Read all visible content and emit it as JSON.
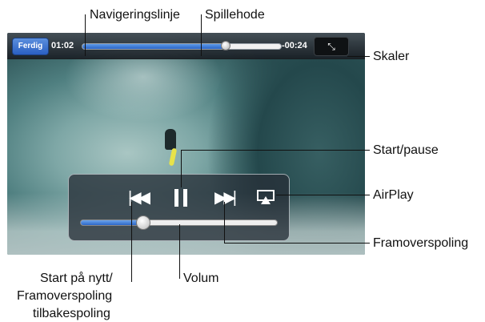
{
  "player": {
    "done_label": "Ferdig",
    "time_elapsed": "01:02",
    "time_remaining": "-00:24",
    "scrub_progress": 0.72,
    "volume_level": 0.32,
    "scale_icon": "shrink-arrows-icon",
    "prev_icon": "skip-back-icon",
    "pause_icon": "pause-icon",
    "next_icon": "skip-forward-icon",
    "airplay_icon": "airplay-icon"
  },
  "callouts": {
    "scrubber": "Navigeringslinje",
    "playhead": "Spillehode",
    "scale": "Skaler",
    "play_pause": "Start/pause",
    "airplay": "AirPlay",
    "fast_forward": "Framoverspoling",
    "restart": "Start på nytt/",
    "rewind_line1": "Framoverspoling",
    "rewind_line2": "tilbakespoling",
    "volume": "Volum"
  },
  "colors": {
    "accent_blue": "#2a64c8",
    "done_button": "#3a6fd0"
  }
}
